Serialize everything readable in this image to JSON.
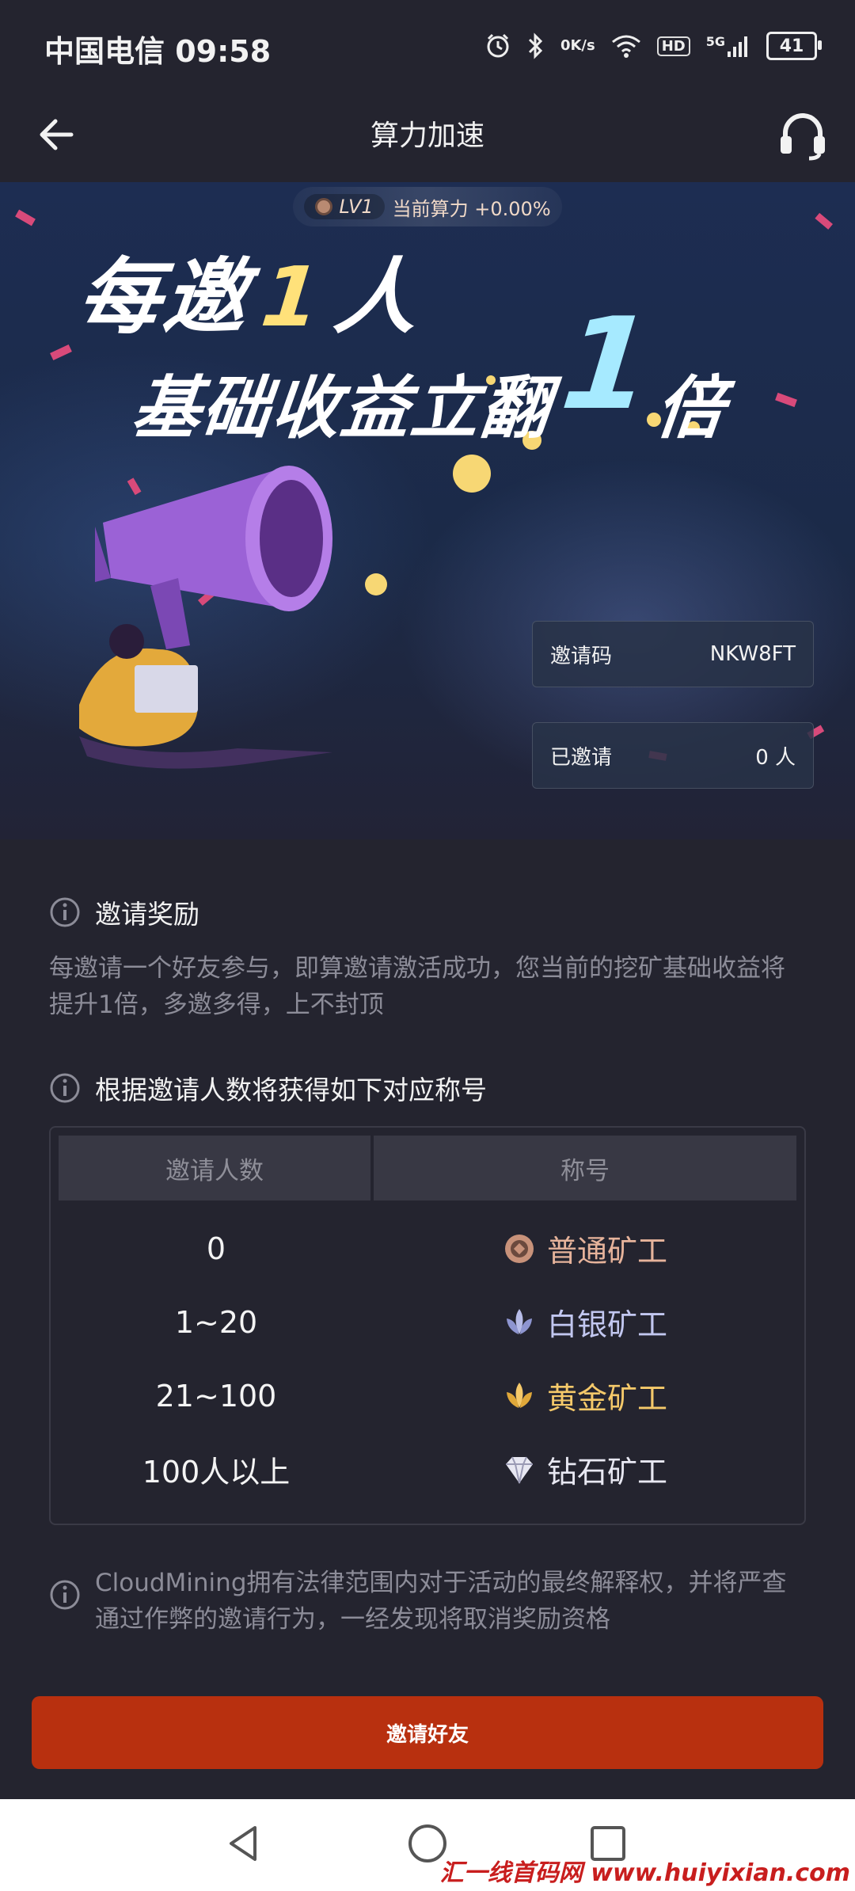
{
  "status_bar": {
    "carrier_time": "中国电信 09:58",
    "net_speed_value": "0",
    "net_speed_unit": "K/s",
    "hd": "HD",
    "signal": "5G",
    "battery": "41"
  },
  "nav": {
    "title": "算力加速"
  },
  "hero": {
    "level": "LV1",
    "current_power": "当前算力 +0.00%",
    "headline_1_pre": "每邀",
    "headline_1_num": "1",
    "headline_1_post": "人",
    "headline_2_pre": "基础收益立翻",
    "headline_2_num": "1",
    "headline_2_post": "倍",
    "invite_code_label": "邀请码",
    "invite_code_value": "NKW8FT",
    "invited_label": "已邀请",
    "invited_value": "0 人"
  },
  "reward": {
    "title": "邀请奖励",
    "desc": "每邀请一个好友参与，即算邀请激活成功，您当前的挖矿基础收益将提升1倍，多邀多得，上不封顶"
  },
  "titles": {
    "heading": "根据邀请人数将获得如下对应称号",
    "col_count": "邀请人数",
    "col_title": "称号",
    "rows": [
      {
        "count": "0",
        "title": "普通矿工",
        "icon": "coin-icon",
        "color": "#e6b39b"
      },
      {
        "count": "1~20",
        "title": "白银矿工",
        "icon": "silver-leaf-icon",
        "color": "#c2c7f0"
      },
      {
        "count": "21~100",
        "title": "黄金矿工",
        "icon": "gold-leaf-icon",
        "color": "#f5c96a"
      },
      {
        "count": "100人以上",
        "title": "钻石矿工",
        "icon": "diamond-icon",
        "color": "#e8e8f2"
      }
    ]
  },
  "disclaimer": "CloudMining拥有法律范围内对于活动的最终解释权，并将严查通过作弊的邀请行为，一经发现将取消奖励资格",
  "invite_button": "邀请好友",
  "watermark": "汇一线首码网 www.huiyixian.com"
}
